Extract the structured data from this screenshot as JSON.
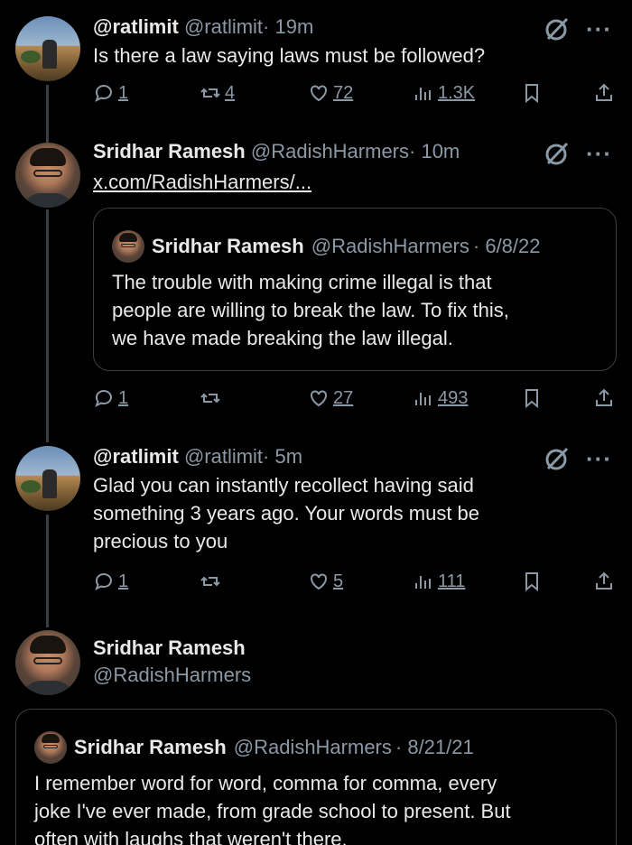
{
  "tweets": [
    {
      "name": "@ratlimit",
      "handle": "@ratlimit",
      "time": "· 19m",
      "text": "Is there a law saying laws must be followed?",
      "replies": "1",
      "reposts": "4",
      "likes": "72",
      "views": "1.3K"
    },
    {
      "name": "Sridhar Ramesh",
      "handle": "@RadishHarmers",
      "time": "· 10m",
      "link": "x.com/RadishHarmers/...",
      "quote": {
        "name": "Sridhar Ramesh",
        "handle": "@RadishHarmers",
        "date": "· 6/8/22",
        "lines": [
          "The trouble with making crime illegal is that",
          "people are willing to break the law. To fix this,",
          "we have made breaking the law illegal."
        ]
      },
      "replies": "1",
      "reposts": "",
      "likes": "27",
      "views": "493"
    },
    {
      "name": "@ratlimit",
      "handle": "@ratlimit",
      "time": "· 5m",
      "lines": [
        "Glad you can instantly recollect having said",
        "something 3 years ago. Your words must be",
        "precious to you"
      ],
      "replies": "1",
      "reposts": "",
      "likes": "5",
      "views": "111"
    }
  ],
  "main_tweet": {
    "name": "Sridhar Ramesh",
    "handle": "@RadishHarmers",
    "quote": {
      "name": "Sridhar Ramesh",
      "handle": "@RadishHarmers",
      "date": "· 8/21/21",
      "lines": [
        "I remember word for word, comma for comma, every",
        "joke I've ever made, from grade school to present. But",
        "often with laughs that weren't there."
      ]
    }
  },
  "icons": {
    "reply": "reply-icon",
    "repost": "repost-icon",
    "like": "heart-icon",
    "views": "views-icon",
    "bookmark": "bookmark-icon",
    "share": "share-icon",
    "grok": "grok-icon",
    "more": "more-icon"
  },
  "colors": {
    "background": "#000000",
    "text": "#e7e9ea",
    "muted": "#8b98a5",
    "border": "#3a3f44"
  }
}
